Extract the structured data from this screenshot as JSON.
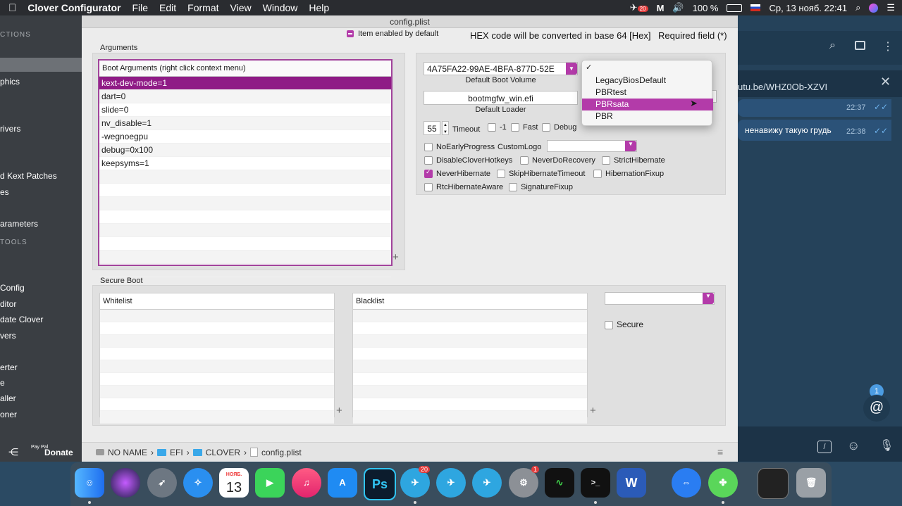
{
  "menubar": {
    "apple": "",
    "app": "Clover Configurator",
    "items": [
      "File",
      "Edit",
      "Format",
      "View",
      "Window",
      "Help"
    ],
    "status_badge": "20",
    "battery": "100 %",
    "datetime": "Ср, 13 нояб.  22:41"
  },
  "sidebar": {
    "headers": [
      "CTIONS",
      "TOOLS"
    ],
    "items": [
      "phics",
      "rivers",
      "d Kext Patches",
      "es",
      "arameters",
      "Config",
      "ditor",
      "date Clover",
      "vers",
      "erter",
      "e",
      "aller",
      "oner"
    ],
    "donate": "Donate",
    "paypal": "Pay Pal"
  },
  "window": {
    "title": "config.plist",
    "item_enabled_label": "Item enabled by default",
    "hex_note": "HEX code will be converted in base 64 [Hex]",
    "required_note": "Required field (*)"
  },
  "arguments": {
    "section_title": "Arguments",
    "table_header": "Boot Arguments (right click context menu)",
    "rows": [
      "kext-dev-mode=1",
      "dart=0",
      "slide=0",
      "nv_disable=1",
      "-wegnoegpu",
      "debug=0x100",
      "keepsyms=1",
      "",
      "",
      "",
      "",
      "",
      "",
      "",
      ""
    ],
    "plus": "+"
  },
  "boot": {
    "volume_value": "4A75FA22-99AE-4BFA-877D-52E",
    "volume_caption": "Default Boot Volume",
    "loader_value": "bootmgfw_win.efi",
    "loader_caption": "Default Loader",
    "timeout_value": "55",
    "timeout_label": "Timeout",
    "opt_minus1": "-1",
    "opt_fast": "Fast",
    "opt_debug": "Debug",
    "no_early_progress": "NoEarlyProgress",
    "custom_logo": "CustomLogo",
    "options": [
      {
        "label": "DisableCloverHotkeys",
        "checked": false
      },
      {
        "label": "NeverDoRecovery",
        "checked": false
      },
      {
        "label": "StrictHibernate",
        "checked": false
      },
      {
        "label": "NeverHibernate",
        "checked": true
      },
      {
        "label": "SkipHibernateTimeout",
        "checked": false
      },
      {
        "label": "HibernationFixup",
        "checked": false
      },
      {
        "label": "RtcHibernateAware",
        "checked": false
      },
      {
        "label": "SignatureFixup",
        "checked": false
      }
    ]
  },
  "popup": {
    "check": "✓",
    "items": [
      "LegacyBiosDefault",
      "PBRtest",
      "PBRsata",
      "PBR"
    ],
    "highlighted": "PBRsata"
  },
  "secure_boot": {
    "section_title": "Secure Boot",
    "whitelist_header": "Whitelist",
    "blacklist_header": "Blacklist",
    "secure_label": "Secure",
    "plus": "+"
  },
  "pathbar": {
    "disk": "NO NAME",
    "sep": "›",
    "folder1": "EFI",
    "folder2": "CLOVER",
    "file": "config.plist"
  },
  "telegram": {
    "link": "utu.be/WHZ0Ob-XZVI",
    "msg1_time": "22:37",
    "msg2_text": "ненавижу такую грудь",
    "msg2_time": "22:38",
    "unread": "1",
    "mention": "@"
  },
  "dock": {
    "calendar_month": "НОЯБ.",
    "calendar_day": "13",
    "telegram_badge": "20",
    "prefs_badge": "1",
    "ps_label": "Ps",
    "word_label": "W"
  }
}
